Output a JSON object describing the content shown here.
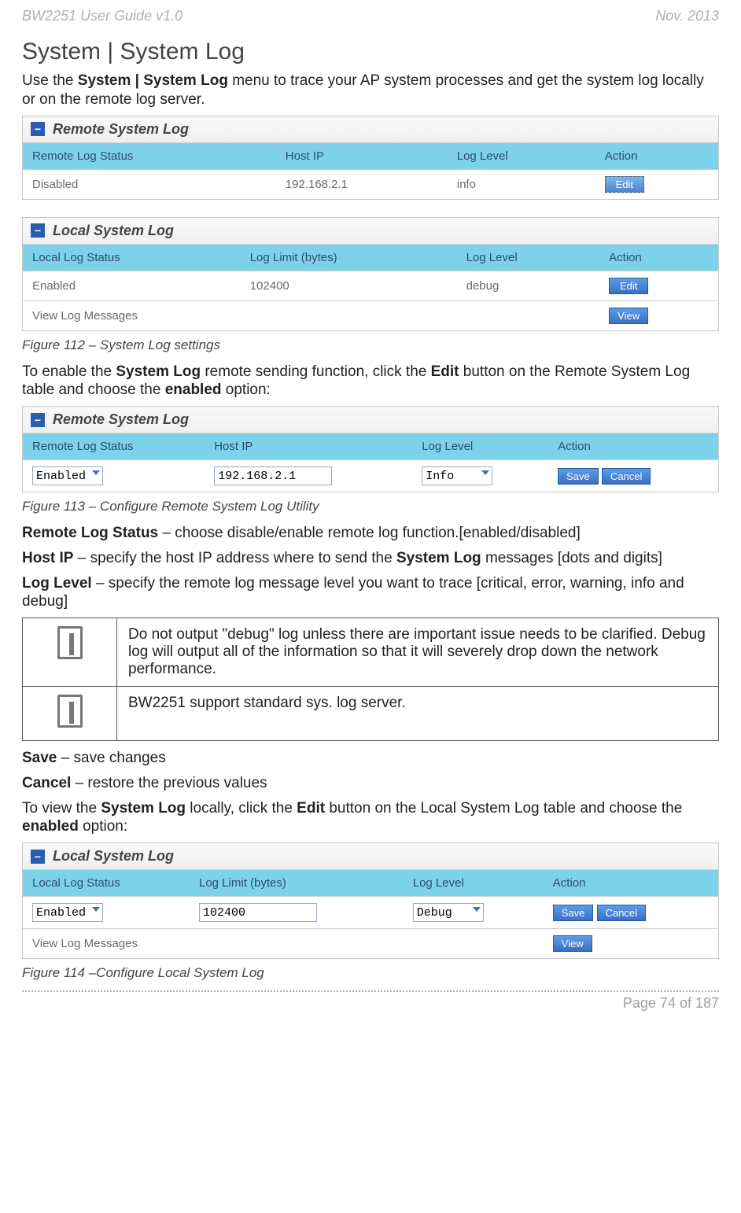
{
  "header": {
    "left": "BW2251 User Guide v1.0",
    "right": "Nov.  2013"
  },
  "title": "System | System Log",
  "intro_pre": "Use the ",
  "intro_bold": "System | System Log",
  "intro_post": " menu to trace your AP system processes and get the system log locally or on the remote log server.",
  "remote_panel": {
    "title": "Remote System Log",
    "cols": [
      "Remote Log Status",
      "Host IP",
      "Log Level",
      "Action"
    ],
    "row": {
      "status": "Disabled",
      "host": "192.168.2.1",
      "level": "info",
      "action": "Edit"
    }
  },
  "local_panel": {
    "title": "Local System Log",
    "cols": [
      "Local Log Status",
      "Log Limit (bytes)",
      "Log Level",
      "Action"
    ],
    "row": {
      "status": "Enabled",
      "limit": "102400",
      "level": "debug",
      "action": "Edit"
    },
    "view_label": "View Log Messages",
    "view_action": "View"
  },
  "fig112": "Figure 112 – System Log settings",
  "para2_pre": "To enable the ",
  "para2_b1": "System Log",
  "para2_mid": " remote sending function, click the ",
  "para2_b2": "Edit",
  "para2_mid2": " button on the Remote System Log table and choose the ",
  "para2_b3": "enabled",
  "para2_post": " option:",
  "remote_edit": {
    "title": "Remote System Log",
    "cols": [
      "Remote Log Status",
      "Host IP",
      "Log Level",
      "Action"
    ],
    "row": {
      "status": "Enabled",
      "host": "192.168.2.1",
      "level": "Info",
      "save": "Save",
      "cancel": "Cancel"
    }
  },
  "fig113": "Figure 113 – Configure Remote System Log Utility",
  "desc_status_b": "Remote Log Status",
  "desc_status_t": " – choose disable/enable remote log function.[enabled/disabled]",
  "desc_host_b": "Host IP",
  "desc_host_t": " – specify the host IP address where to send the ",
  "desc_host_b2": "System Log",
  "desc_host_t2": " messages [dots and digits]",
  "desc_level_b": "Log Level",
  "desc_level_t": " – specify the remote log message level you want to trace [critical, error, warning, info and debug]",
  "note1": "Do not output \"debug\" log unless there are important issue needs to be clarified. Debug log will output all of the information so that it will severely drop down the network performance.",
  "note2": "BW2251 support standard sys. log server.",
  "save_b": "Save",
  "save_t": " – save changes",
  "cancel_b": "Cancel",
  "cancel_t": " – restore the previous values",
  "para3_pre": "To view the ",
  "para3_b1": "System Log",
  "para3_mid": " locally, click the ",
  "para3_b2": "Edit",
  "para3_mid2": " button on the Local System Log table and choose the ",
  "para3_b3": "enabled",
  "para3_post": " option:",
  "local_edit": {
    "title": "Local System Log",
    "cols": [
      "Local Log Status",
      "Log Limit (bytes)",
      "Log Level",
      "Action"
    ],
    "row": {
      "status": "Enabled",
      "limit": "102400",
      "level": "Debug",
      "save": "Save",
      "cancel": "Cancel"
    },
    "view_label": "View Log Messages",
    "view_action": "View"
  },
  "fig114": "Figure 114 –Configure Local System Log",
  "footer": "Page 74 of 187"
}
